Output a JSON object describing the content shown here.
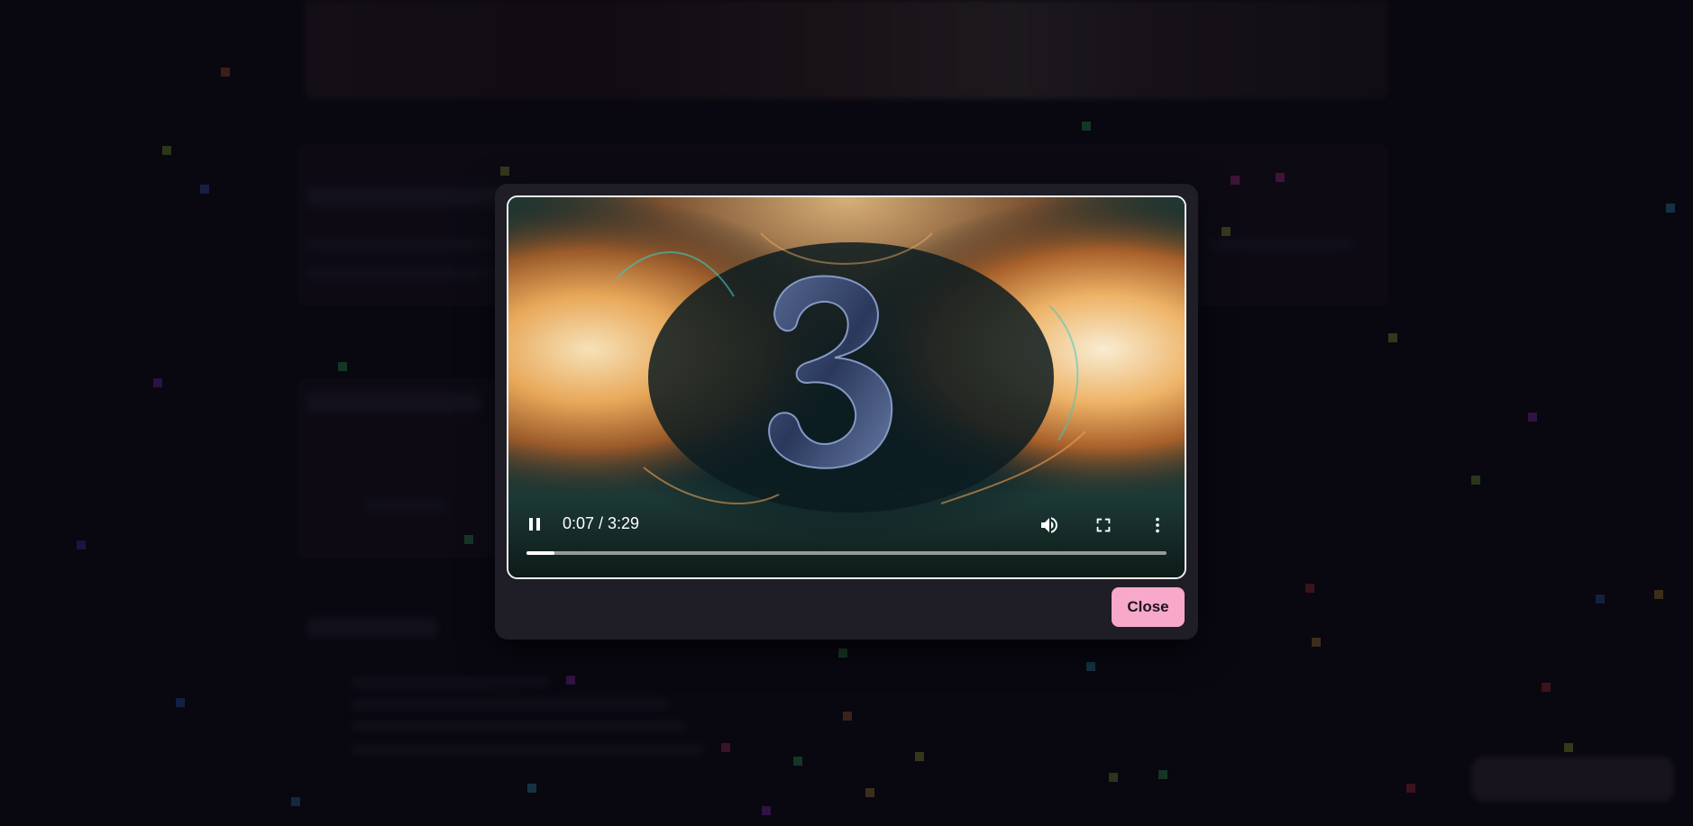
{
  "video_player": {
    "current_time": "0:07",
    "duration": "3:29",
    "time_display": "0:07 / 3:29",
    "progress_fraction": 0.043,
    "frame_content": "3",
    "state": "playing"
  },
  "modal": {
    "close_label": "Close"
  },
  "colors": {
    "close_button": "#f8a8c8",
    "modal_bg": "#1f1d25",
    "page_bg": "#0c0a13"
  },
  "icons": [
    "pause-icon",
    "volume-icon",
    "fullscreen-icon",
    "more-options-icon"
  ]
}
